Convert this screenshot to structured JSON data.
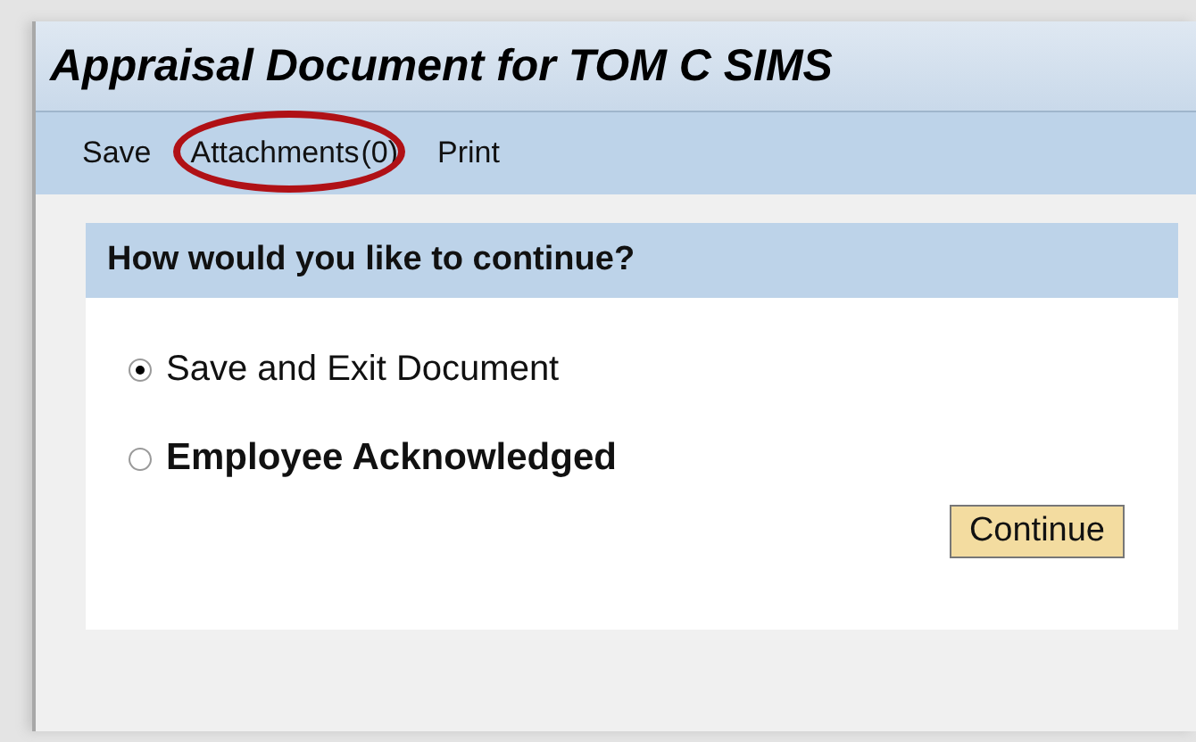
{
  "window": {
    "title": "Appraisal Document for TOM C SIMS"
  },
  "toolbar": [
    {
      "label": "Save",
      "highlighted": false
    },
    {
      "label": "Attachments",
      "count": "(0)",
      "highlighted": true
    },
    {
      "label": "Print",
      "highlighted": false
    }
  ],
  "panel": {
    "title": "How would you like to continue?",
    "options": [
      {
        "label": "Save and Exit Document",
        "selected": true,
        "bold": false
      },
      {
        "label": "Employee Acknowledged",
        "selected": false,
        "bold": true
      }
    ],
    "button": "Continue"
  }
}
